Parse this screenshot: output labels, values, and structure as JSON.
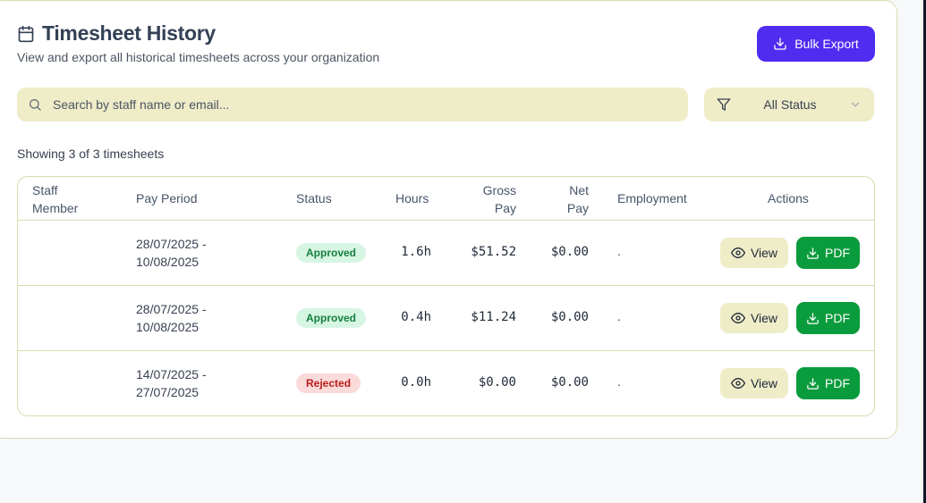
{
  "header": {
    "title": "Timesheet History",
    "subtitle": "View and export all historical timesheets across your organization",
    "icon": "calendar-icon"
  },
  "toolbar": {
    "bulk_export_label": "Bulk Export"
  },
  "search": {
    "placeholder": "Search by staff name or email...",
    "value": ""
  },
  "filter": {
    "selected": "All Status",
    "icon": "filter-icon"
  },
  "summary": {
    "showing_text": "Showing 3 of 3 timesheets"
  },
  "table": {
    "columns": {
      "staff_line1": "Staff",
      "staff_line2": "Member",
      "pay_period": "Pay Period",
      "status": "Status",
      "hours": "Hours",
      "gross_line1": "Gross",
      "gross_line2": "Pay",
      "net_line1": "Net",
      "net_line2": "Pay",
      "employment": "Employment",
      "actions": "Actions"
    },
    "rows": [
      {
        "staff": "",
        "period_start": "28/07/2025 -",
        "period_end": "10/08/2025",
        "status": "Approved",
        "hours": "1.6h",
        "gross": "$51.52",
        "net": "$0.00",
        "employment": ".",
        "view_label": "View",
        "pdf_label": "PDF"
      },
      {
        "staff": "",
        "period_start": "28/07/2025 -",
        "period_end": "10/08/2025",
        "status": "Approved",
        "hours": "0.4h",
        "gross": "$11.24",
        "net": "$0.00",
        "employment": ".",
        "view_label": "View",
        "pdf_label": "PDF"
      },
      {
        "staff": "",
        "period_start": "14/07/2025 -",
        "period_end": "27/07/2025",
        "status": "Rejected",
        "hours": "0.0h",
        "gross": "$0.00",
        "net": "$0.00",
        "employment": ".",
        "view_label": "View",
        "pdf_label": "PDF"
      }
    ]
  },
  "colors": {
    "accent": "#4f2cf0",
    "pdf_green": "#0a9b3c",
    "input_bg": "#efecc8",
    "border": "#d9dcae",
    "approved_bg": "#d7f5e3",
    "rejected_bg": "#fbdada"
  }
}
